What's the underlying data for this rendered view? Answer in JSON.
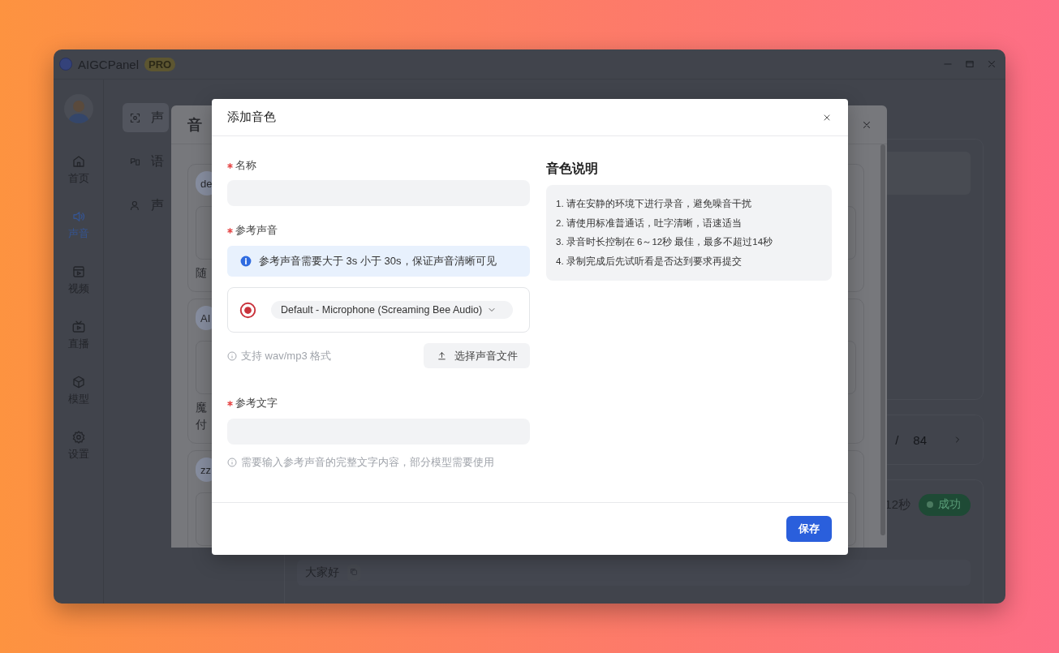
{
  "window": {
    "title": "AIGCPanel",
    "badge": "PRO"
  },
  "nav": [
    {
      "label": "首页",
      "selected": false
    },
    {
      "label": "声音",
      "selected": true
    },
    {
      "label": "视频",
      "selected": false
    },
    {
      "label": "直播",
      "selected": false
    },
    {
      "label": "模型",
      "selected": false
    },
    {
      "label": "设置",
      "selected": false
    }
  ],
  "sub_sidebar": [
    {
      "label": "声",
      "selected": true
    },
    {
      "label": "语",
      "selected": false
    },
    {
      "label": "声",
      "selected": false
    }
  ],
  "pagination": {
    "separator": "/",
    "total": "84"
  },
  "task": {
    "duration": "12秒",
    "status": "成功",
    "sample_text": "大家好"
  },
  "voice_dialog": {
    "title": "音",
    "cards": [
      {
        "tag": "de",
        "lines": [
          "随"
        ]
      },
      {
        "tag": "AI",
        "lines": [
          "魔",
          "付"
        ]
      },
      {
        "tag": "zz"
      }
    ]
  },
  "add_voice_modal": {
    "title": "添加音色",
    "name_field": {
      "label": "名称",
      "required": true
    },
    "reference_audio": {
      "label": "参考声音",
      "required": true,
      "notice": "参考声音需要大于 3s 小于 30s，保证声音清晰可见",
      "device": "Default - Microphone (Screaming Bee Audio)",
      "format_hint": "支持 wav/mp3 格式",
      "upload_button": "选择声音文件"
    },
    "reference_text_field": {
      "label": "参考文字",
      "required": true,
      "hint": "需要输入参考声音的完整文字内容，部分模型需要使用"
    },
    "guide": {
      "title": "音色说明",
      "items": [
        "1. 请在安静的环境下进行录音，避免噪音干扰",
        "2. 请使用标准普通话，吐字清晰，语速适当",
        "3. 录音时长控制在 6～12秒 最佳，最多不超过14秒",
        "4. 录制完成后先试听看是否达到要求再提交"
      ]
    },
    "save_button": "保存"
  }
}
